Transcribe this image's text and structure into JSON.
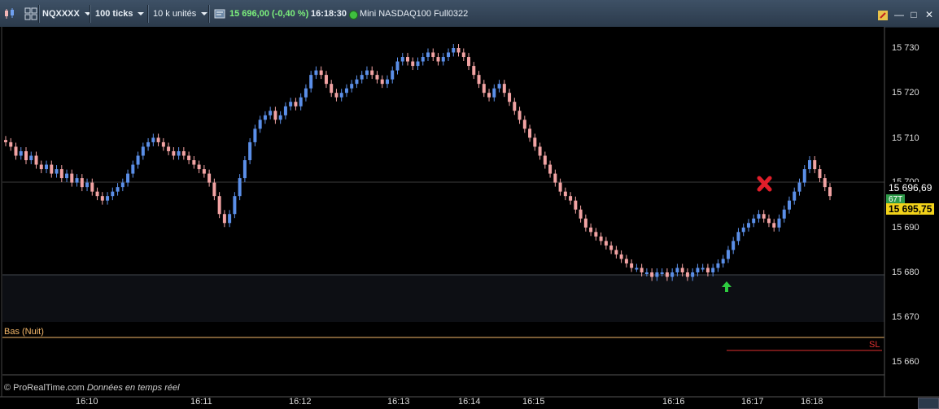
{
  "toolbar": {
    "symbol": "NQXXXX",
    "period": "100 ticks",
    "units": "10 k unités",
    "quote": "15 696,00 (-0,40 %)",
    "time": "16:18:30",
    "instrument": "Mini NASDAQ100 Full0322",
    "icons": [
      "candlestick-icon",
      "grid-icon",
      "settings-icon",
      "minimize-icon",
      "restore-icon",
      "close-icon"
    ]
  },
  "price_axis": {
    "ticks": [
      "15 730",
      "15 720",
      "15 710",
      "15 700",
      "15 690",
      "15 680",
      "15 670",
      "15 660"
    ],
    "current_price": "15 696,69",
    "close_price": "15 695,75",
    "tick_badge": "67T"
  },
  "time_axis": [
    "16:10",
    "16:11",
    "16:12",
    "16:13",
    "16:14",
    "16:15",
    "16:16",
    "16:17",
    "16:18"
  ],
  "panel": {
    "label": "Bas (Nuit)",
    "sl_label": "SL"
  },
  "footer": {
    "source": "© ProRealTime.com",
    "realtime": "Données en temps réel"
  },
  "colors": {
    "up": "#5b8fe8",
    "down": "#f2a3a3",
    "panel_label": "#f5b86a",
    "sl": "#e03030",
    "marker_buy": "#2ecc40",
    "marker_exit": "#e01e2a"
  },
  "chart_data": {
    "type": "candlestick",
    "y_range": [
      15655,
      15736
    ],
    "closes": [
      15709,
      15708,
      15706,
      15707,
      15705,
      15706,
      15704,
      15703,
      15704,
      15702,
      15703,
      15701,
      15702,
      15700,
      15701,
      15699,
      15700,
      15698,
      15697,
      15696,
      15697,
      15698,
      15699,
      15700,
      15702,
      15704,
      15706,
      15708,
      15709,
      15710,
      15709,
      15708,
      15707,
      15706,
      15707,
      15706,
      15705,
      15704,
      15703,
      15702,
      15700,
      15697,
      15693,
      15691,
      15693,
      15697,
      15701,
      15705,
      15709,
      15712,
      15714,
      15715,
      15716,
      15714,
      15715,
      15717,
      15718,
      15717,
      15719,
      15721,
      15724,
      15725,
      15724,
      15722,
      15720,
      15719,
      15720,
      15721,
      15722,
      15723,
      15724,
      15725,
      15724,
      15723,
      15722,
      15723,
      15725,
      15727,
      15728,
      15727,
      15726,
      15727,
      15728,
      15729,
      15728,
      15727,
      15728,
      15729,
      15730,
      15729,
      15728,
      15726,
      15724,
      15722,
      15720,
      15719,
      15721,
      15722,
      15720,
      15718,
      15716,
      15714,
      15712,
      15710,
      15708,
      15706,
      15704,
      15702,
      15700,
      15698,
      15697,
      15696,
      15694,
      15692,
      15690,
      15689,
      15688,
      15687,
      15686,
      15685,
      15684,
      15683,
      15682,
      15681,
      15681,
      15680,
      15680,
      15679,
      15680,
      15680,
      15679,
      15680,
      15681,
      15680,
      15679,
      15680,
      15681,
      15681,
      15680,
      15681,
      15682,
      15683,
      15685,
      15687,
      15689,
      15690,
      15691,
      15692,
      15693,
      15692,
      15691,
      15690,
      15692,
      15694,
      15696,
      15698,
      15700,
      15703,
      15705,
      15703,
      15701,
      15699,
      15697
    ]
  }
}
